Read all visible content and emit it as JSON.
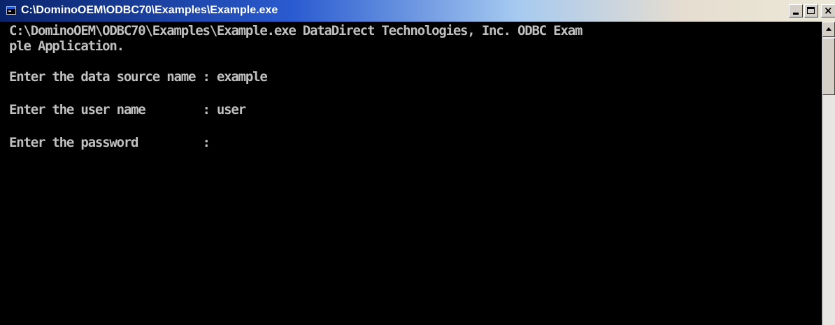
{
  "window": {
    "title": "C:\\DominoOEM\\ODBC70\\Examples\\Example.exe",
    "icon": "console-window-icon",
    "controls": {
      "minimize_icon": "minimize-icon",
      "maximize_icon": "maximize-icon",
      "close_label": "×"
    }
  },
  "console": {
    "text_color": "#c0c0c0",
    "background": "#000000",
    "lines": [
      "C:\\DominoOEM\\ODBC70\\Examples\\Example.exe DataDirect Technologies, Inc. ODBC Exam",
      "ple Application.",
      "Enter the data source name : example",
      "Enter the user name        : user",
      "Enter the password         :"
    ]
  },
  "scrollbar": {
    "up_icon": "scroll-up-arrow-icon"
  }
}
